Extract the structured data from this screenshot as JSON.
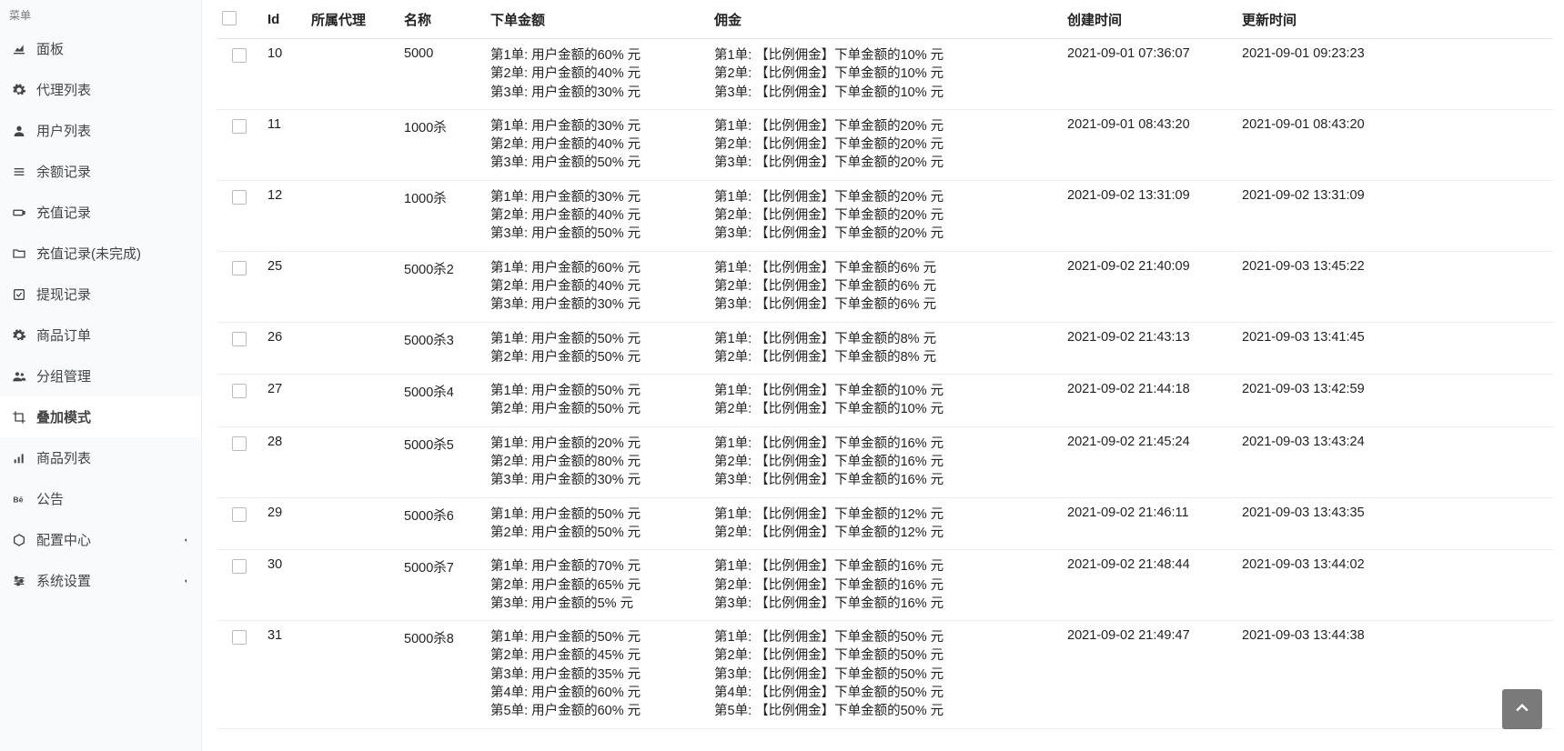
{
  "sidebar": {
    "title": "菜单",
    "items": [
      {
        "name": "panel",
        "label": "面板",
        "icon": "chart-area",
        "caret": false,
        "active": false
      },
      {
        "name": "agents",
        "label": "代理列表",
        "icon": "gear",
        "caret": false,
        "active": false
      },
      {
        "name": "users",
        "label": "用户列表",
        "icon": "user",
        "caret": false,
        "active": false
      },
      {
        "name": "balance",
        "label": "余额记录",
        "icon": "list",
        "caret": false,
        "active": false
      },
      {
        "name": "recharge",
        "label": "充值记录",
        "icon": "battery",
        "caret": false,
        "active": false
      },
      {
        "name": "recharge-pending",
        "label": "充值记录(未完成)",
        "icon": "folder",
        "caret": false,
        "active": false
      },
      {
        "name": "withdraw",
        "label": "提现记录",
        "icon": "check-square",
        "caret": false,
        "active": false
      },
      {
        "name": "orders",
        "label": "商品订单",
        "icon": "gear",
        "caret": false,
        "active": false
      },
      {
        "name": "groups",
        "label": "分组管理",
        "icon": "users",
        "caret": false,
        "active": false
      },
      {
        "name": "overlay",
        "label": "叠加模式",
        "icon": "crop",
        "caret": false,
        "active": true
      },
      {
        "name": "products",
        "label": "商品列表",
        "icon": "signal",
        "caret": false,
        "active": false
      },
      {
        "name": "announce",
        "label": "公告",
        "icon": "behance",
        "caret": false,
        "active": false
      },
      {
        "name": "config",
        "label": "配置中心",
        "icon": "hexagon",
        "caret": true,
        "active": false
      },
      {
        "name": "system",
        "label": "系统设置",
        "icon": "sliders",
        "caret": true,
        "active": false
      }
    ]
  },
  "table": {
    "headers": {
      "id": "Id",
      "agent": "所属代理",
      "name": "名称",
      "orderAmount": "下单金额",
      "commission": "佣金",
      "created": "创建时间",
      "updated": "更新时间"
    },
    "rows": [
      {
        "id": "10",
        "agent": "",
        "name": "5000",
        "orderLines": [
          "第1单: 用户金额的60% 元",
          "第2单: 用户金额的40% 元",
          "第3单: 用户金额的30% 元"
        ],
        "commLines": [
          "第1单: 【比例佣金】下单金额的10% 元",
          "第2单: 【比例佣金】下单金额的10% 元",
          "第3单: 【比例佣金】下单金额的10% 元"
        ],
        "created": "2021-09-01 07:36:07",
        "updated": "2021-09-01 09:23:23"
      },
      {
        "id": "11",
        "agent": "",
        "name": "1000杀",
        "orderLines": [
          "第1单: 用户金额的30% 元",
          "第2单: 用户金额的40% 元",
          "第3单: 用户金额的50% 元"
        ],
        "commLines": [
          "第1单: 【比例佣金】下单金额的20% 元",
          "第2单: 【比例佣金】下单金额的20% 元",
          "第3单: 【比例佣金】下单金额的20% 元"
        ],
        "created": "2021-09-01 08:43:20",
        "updated": "2021-09-01 08:43:20"
      },
      {
        "id": "12",
        "agent": "",
        "name": "1000杀",
        "orderLines": [
          "第1单: 用户金额的30% 元",
          "第2单: 用户金额的40% 元",
          "第3单: 用户金额的50% 元"
        ],
        "commLines": [
          "第1单: 【比例佣金】下单金额的20% 元",
          "第2单: 【比例佣金】下单金额的20% 元",
          "第3单: 【比例佣金】下单金额的20% 元"
        ],
        "created": "2021-09-02 13:31:09",
        "updated": "2021-09-02 13:31:09"
      },
      {
        "id": "25",
        "agent": "",
        "name": "5000杀2",
        "orderLines": [
          "第1单: 用户金额的60% 元",
          "第2单: 用户金额的40% 元",
          "第3单: 用户金额的30% 元"
        ],
        "commLines": [
          "第1单: 【比例佣金】下单金额的6% 元",
          "第2单: 【比例佣金】下单金额的6% 元",
          "第3单: 【比例佣金】下单金额的6% 元"
        ],
        "created": "2021-09-02 21:40:09",
        "updated": "2021-09-03 13:45:22"
      },
      {
        "id": "26",
        "agent": "",
        "name": "5000杀3",
        "orderLines": [
          "第1单: 用户金额的50% 元",
          "第2单: 用户金额的50% 元"
        ],
        "commLines": [
          "第1单: 【比例佣金】下单金额的8% 元",
          "第2单: 【比例佣金】下单金额的8% 元"
        ],
        "created": "2021-09-02 21:43:13",
        "updated": "2021-09-03 13:41:45"
      },
      {
        "id": "27",
        "agent": "",
        "name": "5000杀4",
        "orderLines": [
          "第1单: 用户金额的50% 元",
          "第2单: 用户金额的50% 元"
        ],
        "commLines": [
          "第1单: 【比例佣金】下单金额的10% 元",
          "第2单: 【比例佣金】下单金额的10% 元"
        ],
        "created": "2021-09-02 21:44:18",
        "updated": "2021-09-03 13:42:59"
      },
      {
        "id": "28",
        "agent": "",
        "name": "5000杀5",
        "orderLines": [
          "第1单: 用户金额的20% 元",
          "第2单: 用户金额的80% 元",
          "第3单: 用户金额的30% 元"
        ],
        "commLines": [
          "第1单: 【比例佣金】下单金额的16% 元",
          "第2单: 【比例佣金】下单金额的16% 元",
          "第3单: 【比例佣金】下单金额的16% 元"
        ],
        "created": "2021-09-02 21:45:24",
        "updated": "2021-09-03 13:43:24"
      },
      {
        "id": "29",
        "agent": "",
        "name": "5000杀6",
        "orderLines": [
          "第1单: 用户金额的50% 元",
          "第2单: 用户金额的50% 元"
        ],
        "commLines": [
          "第1单: 【比例佣金】下单金额的12% 元",
          "第2单: 【比例佣金】下单金额的12% 元"
        ],
        "created": "2021-09-02 21:46:11",
        "updated": "2021-09-03 13:43:35"
      },
      {
        "id": "30",
        "agent": "",
        "name": "5000杀7",
        "orderLines": [
          "第1单: 用户金额的70% 元",
          "第2单: 用户金额的65% 元",
          "第3单: 用户金额的5% 元"
        ],
        "commLines": [
          "第1单: 【比例佣金】下单金额的16% 元",
          "第2单: 【比例佣金】下单金额的16% 元",
          "第3单: 【比例佣金】下单金额的16% 元"
        ],
        "created": "2021-09-02 21:48:44",
        "updated": "2021-09-03 13:44:02"
      },
      {
        "id": "31",
        "agent": "",
        "name": "5000杀8",
        "orderLines": [
          "第1单: 用户金额的50% 元",
          "第2单: 用户金额的45% 元",
          "第3单: 用户金额的35% 元",
          "第4单: 用户金额的60% 元",
          "第5单: 用户金额的60% 元"
        ],
        "commLines": [
          "第1单: 【比例佣金】下单金额的50% 元",
          "第2单: 【比例佣金】下单金额的50% 元",
          "第3单: 【比例佣金】下单金额的50% 元",
          "第4单: 【比例佣金】下单金额的50% 元",
          "第5单: 【比例佣金】下单金额的50% 元"
        ],
        "created": "2021-09-02 21:49:47",
        "updated": "2021-09-03 13:44:38"
      }
    ]
  }
}
